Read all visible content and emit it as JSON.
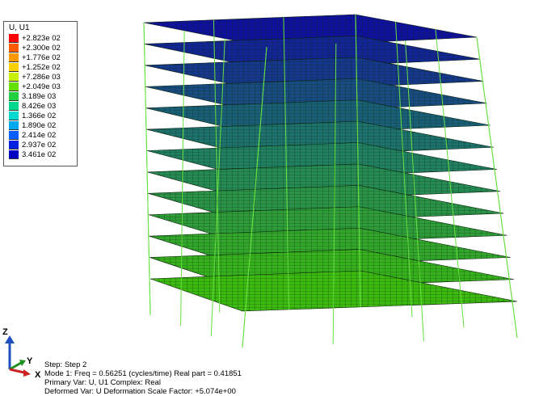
{
  "legend": {
    "title": "U, U1",
    "entries": [
      {
        "label": "+2.823e 02",
        "color": "#ff0000"
      },
      {
        "label": "+2.300e 02",
        "color": "#ff5a00"
      },
      {
        "label": "+1.776e 02",
        "color": "#ff9900"
      },
      {
        "label": "+1.252e 02",
        "color": "#ffd000"
      },
      {
        "label": "+7.286e 03",
        "color": "#c8f000"
      },
      {
        "label": "+2.049e 03",
        "color": "#66e000"
      },
      {
        "label": "3.189e 03",
        "color": "#22d040"
      },
      {
        "label": "8.426e 03",
        "color": "#00d890"
      },
      {
        "label": "1.366e 02",
        "color": "#00d8d0"
      },
      {
        "label": "1.890e 02",
        "color": "#00a8f0"
      },
      {
        "label": "2.414e 02",
        "color": "#0060ff"
      },
      {
        "label": "2.937e 02",
        "color": "#0020e0"
      },
      {
        "label": "3.461e 02",
        "color": "#0000c0"
      }
    ]
  },
  "triad": {
    "z": "Z",
    "y": "Y",
    "x": "X"
  },
  "info": {
    "step": "Step: Step  2",
    "mode": "Mode      1: Freq =  0.56251    (cycles/time) Real part =  0.41851",
    "primary": "Primary Var: U, U1   Complex: Real",
    "deformed": "Deformed Var: U   Deformation Scale Factor: +5.074e+00"
  },
  "model": {
    "floor_count": 13
  }
}
